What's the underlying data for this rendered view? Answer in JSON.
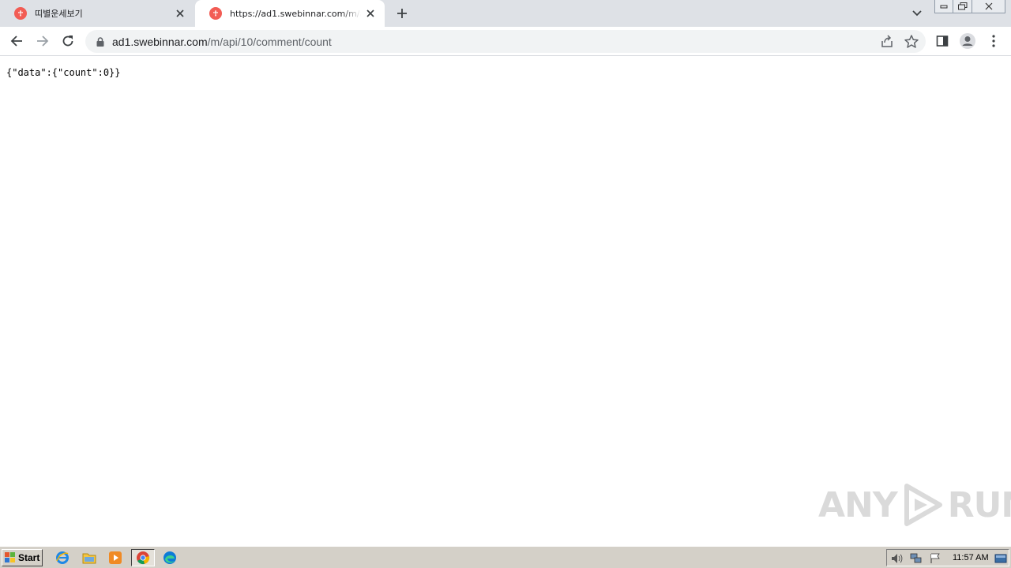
{
  "tabs": [
    {
      "title": "띠별운세보기",
      "favicon": "fortune-site-favicon",
      "active": false
    },
    {
      "title": "https://ad1.swebinnar.com/m/api/10/comment/count",
      "favicon": "fortune-site-favicon",
      "active": true
    }
  ],
  "toolbar": {
    "url_host": "ad1.swebinnar.com",
    "url_path": "/m/api/10/comment/count"
  },
  "page": {
    "json_text": "{\"data\":{\"count\":0}}"
  },
  "watermark": {
    "left": "ANY",
    "right": "RUN"
  },
  "taskbar": {
    "start_label": "Start",
    "quick_launch": [
      "internet-explorer-icon",
      "file-explorer-icon",
      "media-player-icon",
      "chrome-icon",
      "edge-icon"
    ],
    "clock": "11:57 AM"
  },
  "colors": {
    "tabstrip_bg": "#dee1e6",
    "favicon_red": "#f25c54",
    "omnibox_bg": "#f1f3f4",
    "taskbar_bg": "#d4d0c8"
  }
}
